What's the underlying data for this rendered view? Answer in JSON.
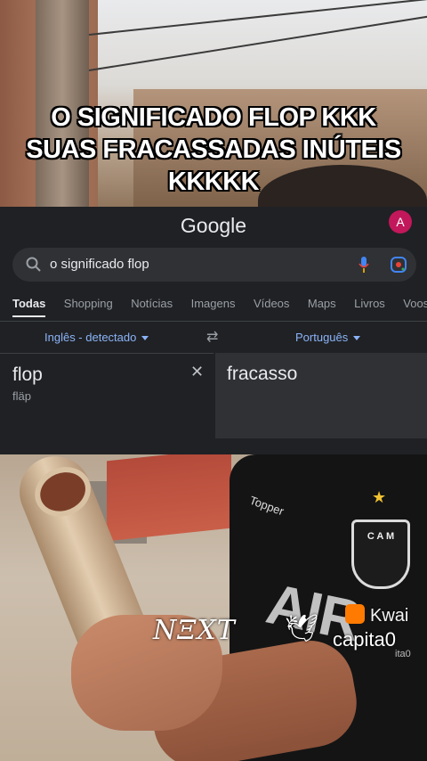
{
  "caption": {
    "line1": "O SIGNIFICADO FLOP KKK",
    "line2": "SUAS FRACASSADAS INÚTEIS",
    "line3": "KKKKK"
  },
  "google": {
    "logo": "Google",
    "avatar_letter": "A",
    "search_query": "o significado flop",
    "tabs": [
      "Todas",
      "Shopping",
      "Notícias",
      "Imagens",
      "Vídeos",
      "Maps",
      "Livros",
      "Voos"
    ],
    "active_tab": "Todas",
    "translate": {
      "source_lang": "Inglês - detectado",
      "target_lang": "Português",
      "source_word": "flop",
      "source_phonetic": "fläp",
      "target_word": "fracasso"
    }
  },
  "overlay": {
    "next_logo": "NΞXT",
    "kwai_label": "Kwai",
    "username": "capita0",
    "username_sub": "ita0"
  },
  "jersey": {
    "badge_text": "C A M",
    "brand": "Topper",
    "sponsor": "AIR"
  },
  "colors": {
    "panel_bg": "#202124",
    "link_blue": "#8ab4f8",
    "avatar": "#c2185b",
    "kwai_orange": "#ff7a00"
  }
}
